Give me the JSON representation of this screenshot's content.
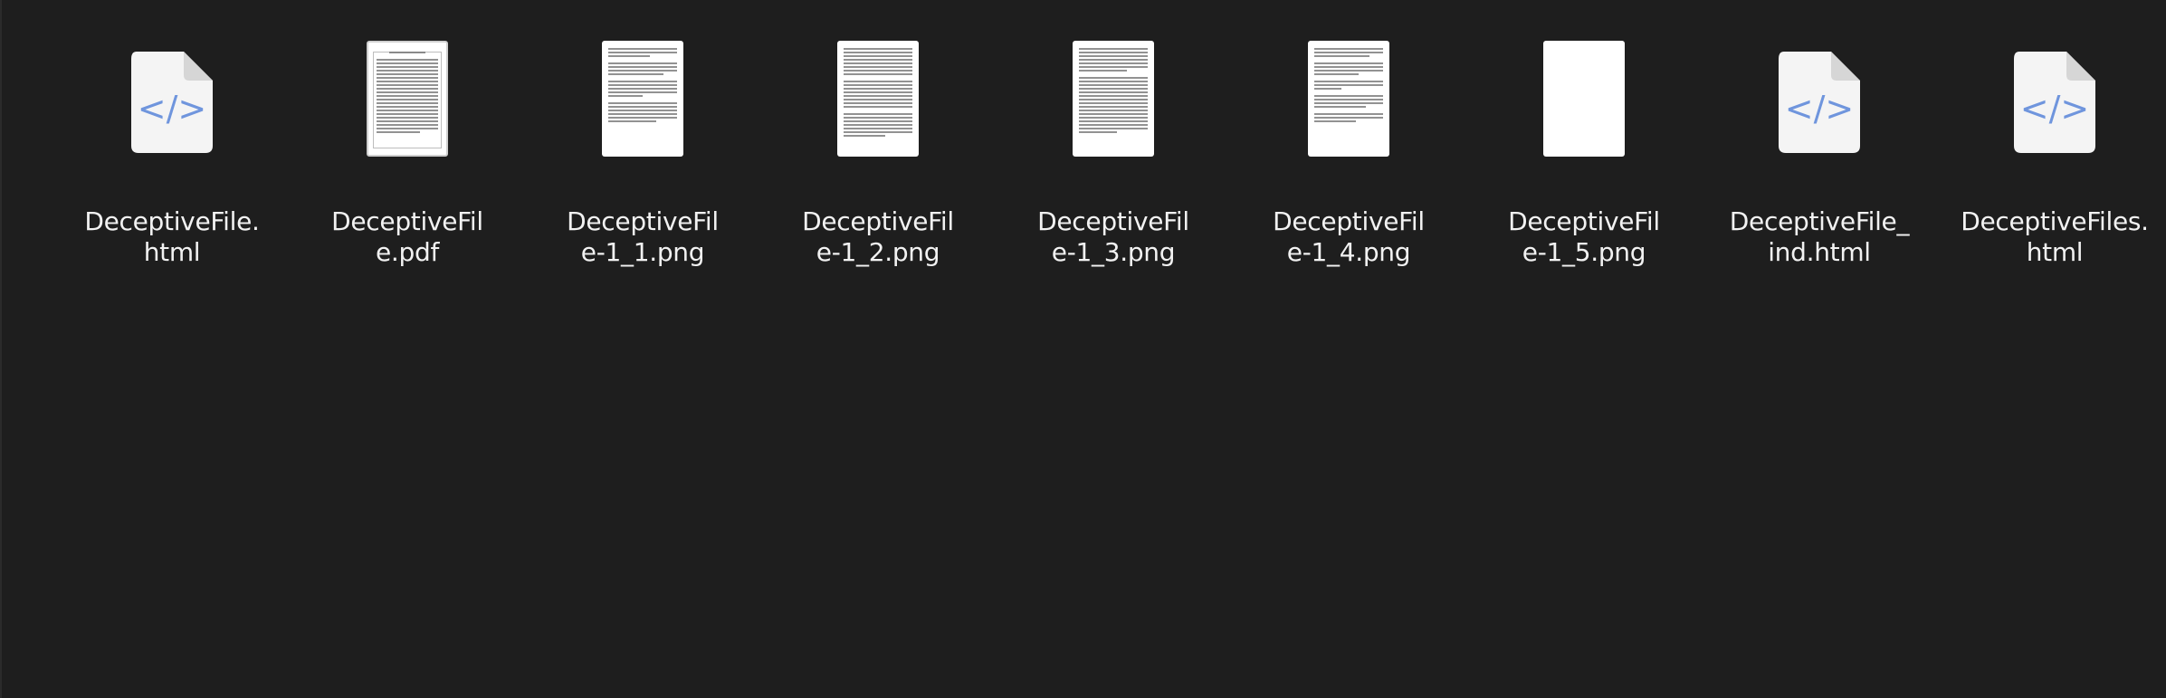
{
  "files": [
    {
      "line1": "DeceptiveFile.",
      "line2": "html",
      "icon": "html-file-icon",
      "thumb": "html"
    },
    {
      "line1": "DeceptiveFil",
      "line2": "e.pdf",
      "icon": "pdf-thumbnail-icon",
      "thumb": "pdf"
    },
    {
      "line1": "DeceptiveFil",
      "line2": "e-1_1.png",
      "icon": "image-thumbnail-icon",
      "thumb": "doc"
    },
    {
      "line1": "DeceptiveFil",
      "line2": "e-1_2.png",
      "icon": "image-thumbnail-icon",
      "thumb": "doc-dense"
    },
    {
      "line1": "DeceptiveFil",
      "line2": "e-1_3.png",
      "icon": "image-thumbnail-icon",
      "thumb": "doc-dense"
    },
    {
      "line1": "DeceptiveFil",
      "line2": "e-1_4.png",
      "icon": "image-thumbnail-icon",
      "thumb": "doc"
    },
    {
      "line1": "DeceptiveFil",
      "line2": "e-1_5.png",
      "icon": "image-thumbnail-icon",
      "thumb": "blank"
    },
    {
      "line1": "DeceptiveFile_",
      "line2": "ind.html",
      "icon": "html-file-icon",
      "thumb": "html"
    },
    {
      "line1": "DeceptiveFiles.",
      "line2": "html",
      "icon": "html-file-icon",
      "thumb": "html"
    }
  ],
  "colors": {
    "background": "#1e1e1e",
    "html_icon_accent": "#6f95dd",
    "html_icon_page": "#f4f4f4"
  }
}
